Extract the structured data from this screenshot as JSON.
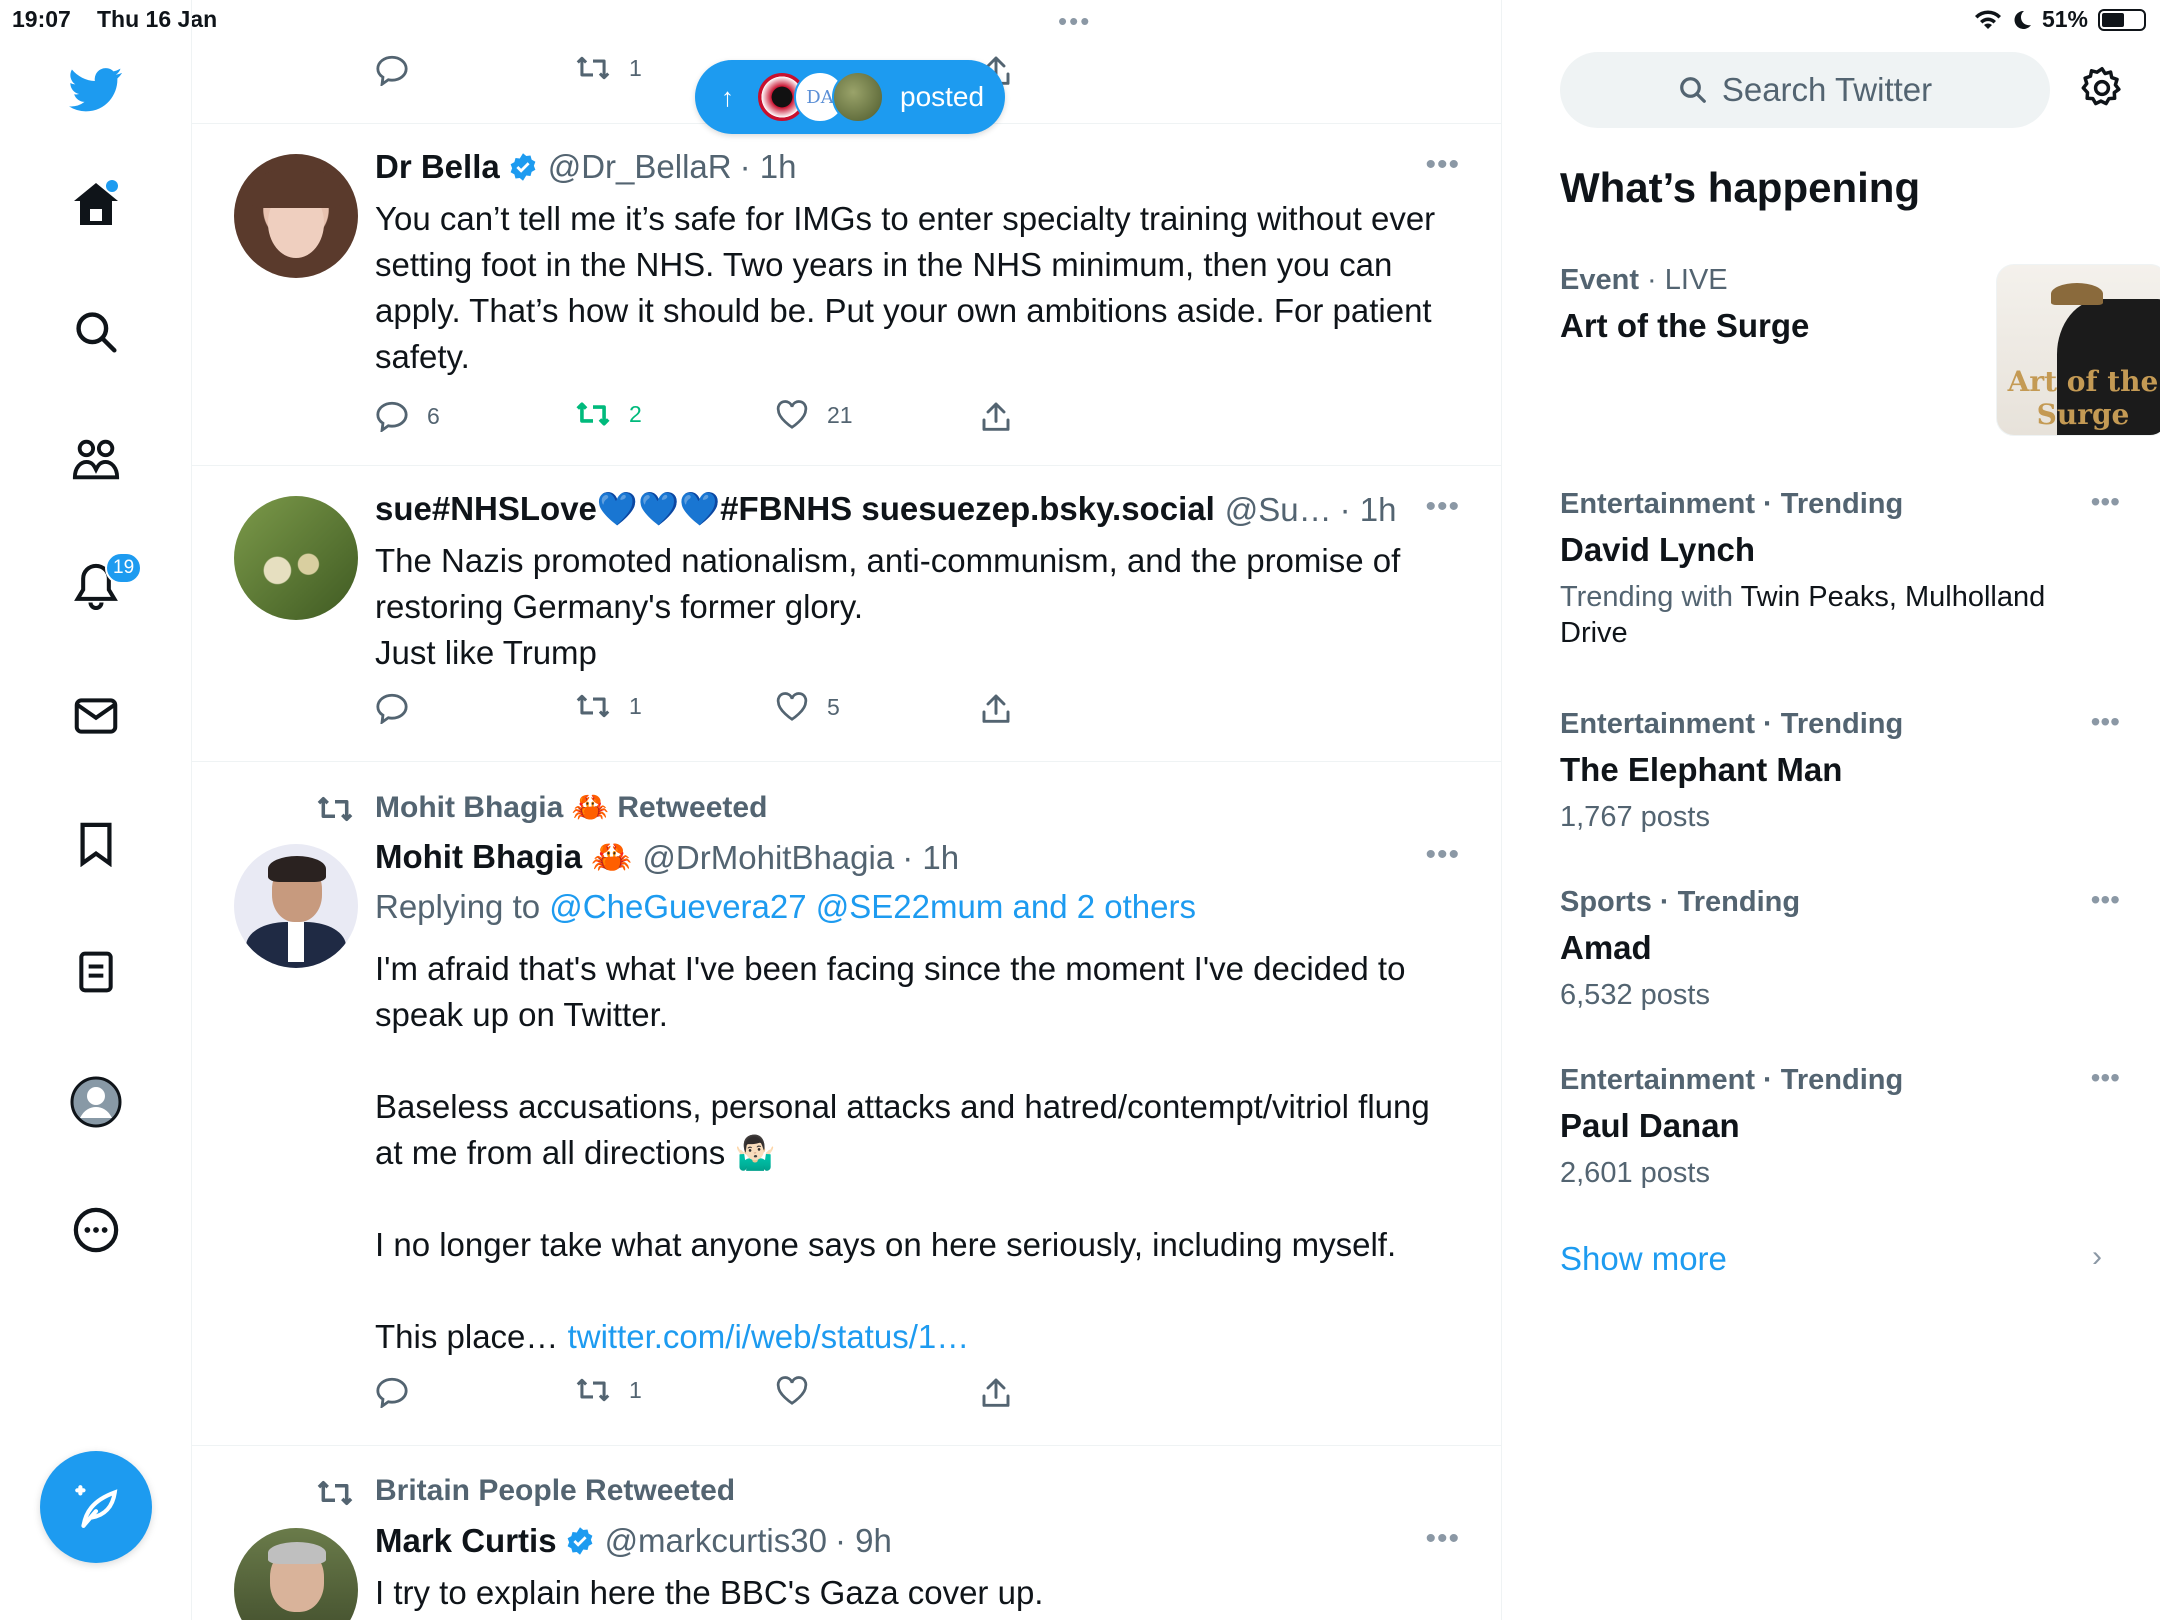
{
  "status_bar": {
    "time": "19:07",
    "date": "Thu 16 Jan",
    "battery": "51%",
    "battery_level": 0.51
  },
  "nav": {
    "notifications_badge": "19"
  },
  "pill": {
    "label": "posted"
  },
  "tweets": [
    {
      "actions": {
        "reply": "",
        "retweet": "1"
      }
    },
    {
      "name": "Dr Bella",
      "verified": true,
      "handle": "@Dr_BellaR",
      "time": "· 1h",
      "text": "You can’t tell me it’s safe for IMGs to enter specialty training without ever setting foot in the NHS. Two years in the NHS minimum, then you can apply.  That’s how it should be. Put your own ambitions aside. For patient safety.",
      "actions": {
        "reply": "6",
        "retweet": "2",
        "like": "21"
      }
    },
    {
      "name": "sue#NHSLove💙💙💙#FBNHS suesuezep.bsky.social",
      "handle": "@Su…",
      "time": "· 1h",
      "text_lines": [
        "The Nazis promoted nationalism, anti-communism, and the promise of restoring Germany's former glory.",
        "Just like Trump"
      ],
      "actions": {
        "reply": "",
        "retweet": "1",
        "like": "5"
      }
    },
    {
      "retweeted_by": "Mohit Bhagia 🦀 Retweeted",
      "name": "Mohit Bhagia 🦀",
      "handle": "@DrMohitBhagia",
      "time": "· 1h",
      "replying_prefix": "Replying to",
      "replying_to": "@CheGuevera27 @SE22mum and 2 others",
      "paragraphs": [
        "I'm afraid that's what I've been facing since the moment I've decided to speak up on Twitter.",
        "Baseless accusations, personal attacks and hatred/contempt/vitriol flung at me from all directions 🤷🏻‍♂️",
        "I no longer take what anyone says on here seriously, including myself."
      ],
      "last_prefix": "This place…",
      "link": "twitter.com/i/web/status/1…",
      "actions": {
        "reply": "",
        "retweet": "1",
        "like": ""
      }
    },
    {
      "retweeted_by": "Britain People Retweeted",
      "name": "Mark Curtis",
      "verified": true,
      "handle": "@markcurtis30",
      "time": "· 9h",
      "text": "I try to explain here the BBC's Gaza cover up."
    }
  ],
  "sidebar": {
    "search_placeholder": "Search Twitter",
    "title": "What’s happening",
    "trends": [
      {
        "category": "Event",
        "sep": " · ",
        "status": "LIVE",
        "name": "Art of the Surge",
        "image_text": "Art of the Surge"
      },
      {
        "meta": "Entertainment · Trending",
        "name": "David Lynch",
        "with_prefix": "Trending with",
        "with": "Twin Peaks, Mulholland Drive"
      },
      {
        "meta": "Entertainment · Trending",
        "name": "The Elephant Man",
        "posts": "1,767 posts"
      },
      {
        "meta": "Sports · Trending",
        "name": "Amad",
        "posts": "6,532 posts"
      },
      {
        "meta": "Entertainment · Trending",
        "name": "Paul Danan",
        "posts": "2,601 posts"
      }
    ],
    "show_more": "Show more"
  },
  "colors": {
    "accent": "#1d9bf0",
    "retweet_green": "#00ba7c",
    "secondary_text": "#536471"
  }
}
